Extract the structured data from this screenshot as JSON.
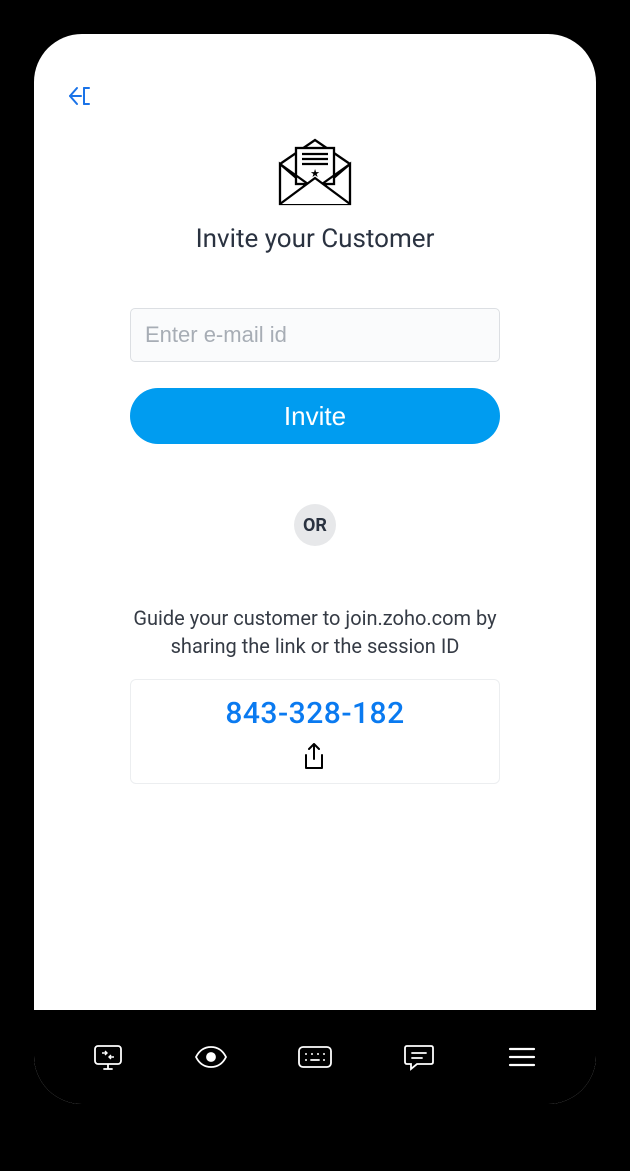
{
  "header": {
    "title": "Invite your Customer"
  },
  "form": {
    "email_placeholder": "Enter e-mail id",
    "invite_label": "Invite"
  },
  "separator": {
    "or_label": "OR"
  },
  "guide": {
    "text": "Guide your customer to join.zoho.com by sharing the link or the session ID"
  },
  "session": {
    "id": "843-328-182"
  },
  "nav": {
    "items": [
      "screen-swap",
      "view",
      "keyboard",
      "chat",
      "menu"
    ]
  },
  "colors": {
    "accent": "#009cf0",
    "link": "#0a7af0"
  }
}
